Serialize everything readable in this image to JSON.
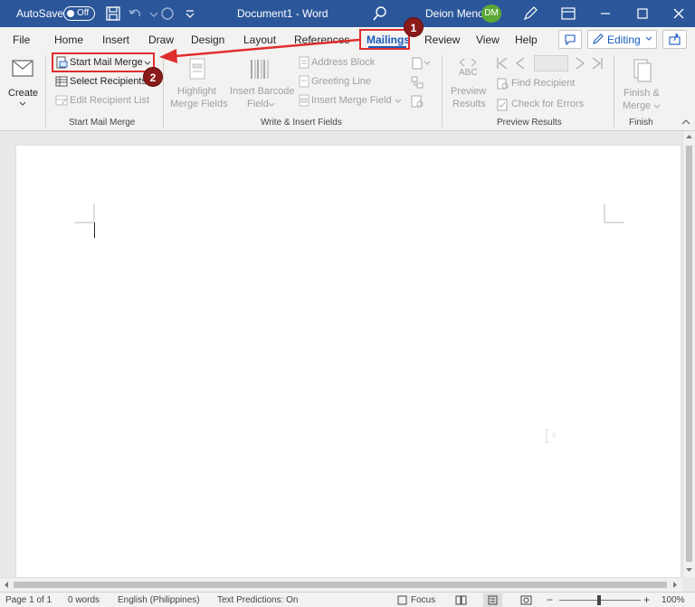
{
  "titlebar": {
    "autosave_label": "AutoSave",
    "autosave_state": "Off",
    "doc_title": "Document1  -  Word",
    "user_name": "Deion  Menor",
    "avatar_initials": "DM"
  },
  "tabs": [
    "File",
    "Home",
    "Insert",
    "Draw",
    "Design",
    "Layout",
    "References",
    "Mailings",
    "Review",
    "View",
    "Help"
  ],
  "active_tab": "Mailings",
  "ribbon_right": {
    "editing_label": "Editing"
  },
  "ribbon": {
    "create": {
      "label": "Create"
    },
    "start_mail_merge": {
      "start_label": "Start Mail Merge",
      "select_recipients": "Select Recipients",
      "edit_recipient_list": "Edit Recipient List",
      "group_label": "Start Mail Merge"
    },
    "write_insert": {
      "highlight_line1": "Highlight",
      "highlight_line2": "Merge Fields",
      "barcode_line1": "Insert Barcode",
      "barcode_line2": "Field",
      "address_block": "Address Block",
      "greeting_line": "Greeting Line",
      "insert_merge_field": "Insert Merge Field",
      "group_label": "Write & Insert Fields"
    },
    "preview": {
      "abc_label": "ABC",
      "preview_line1": "Preview",
      "preview_line2": "Results",
      "find_recipient": "Find Recipient",
      "check_for_errors": "Check for Errors",
      "group_label": "Preview Results"
    },
    "finish": {
      "finish_line1": "Finish &",
      "finish_line2": "Merge",
      "group_label": "Finish"
    }
  },
  "status": {
    "page": "Page 1 of 1",
    "words": "0 words",
    "language": "English (Philippines)",
    "text_predictions": "Text Predictions: On",
    "focus": "Focus",
    "zoom": "100%"
  },
  "annotations": {
    "badge1": "1",
    "badge2": "2",
    "arrow_color": "#e02d2d"
  },
  "colors": {
    "titlebar": "#2b579a",
    "accent": "#185abd",
    "annotation": "#e02d2d"
  }
}
